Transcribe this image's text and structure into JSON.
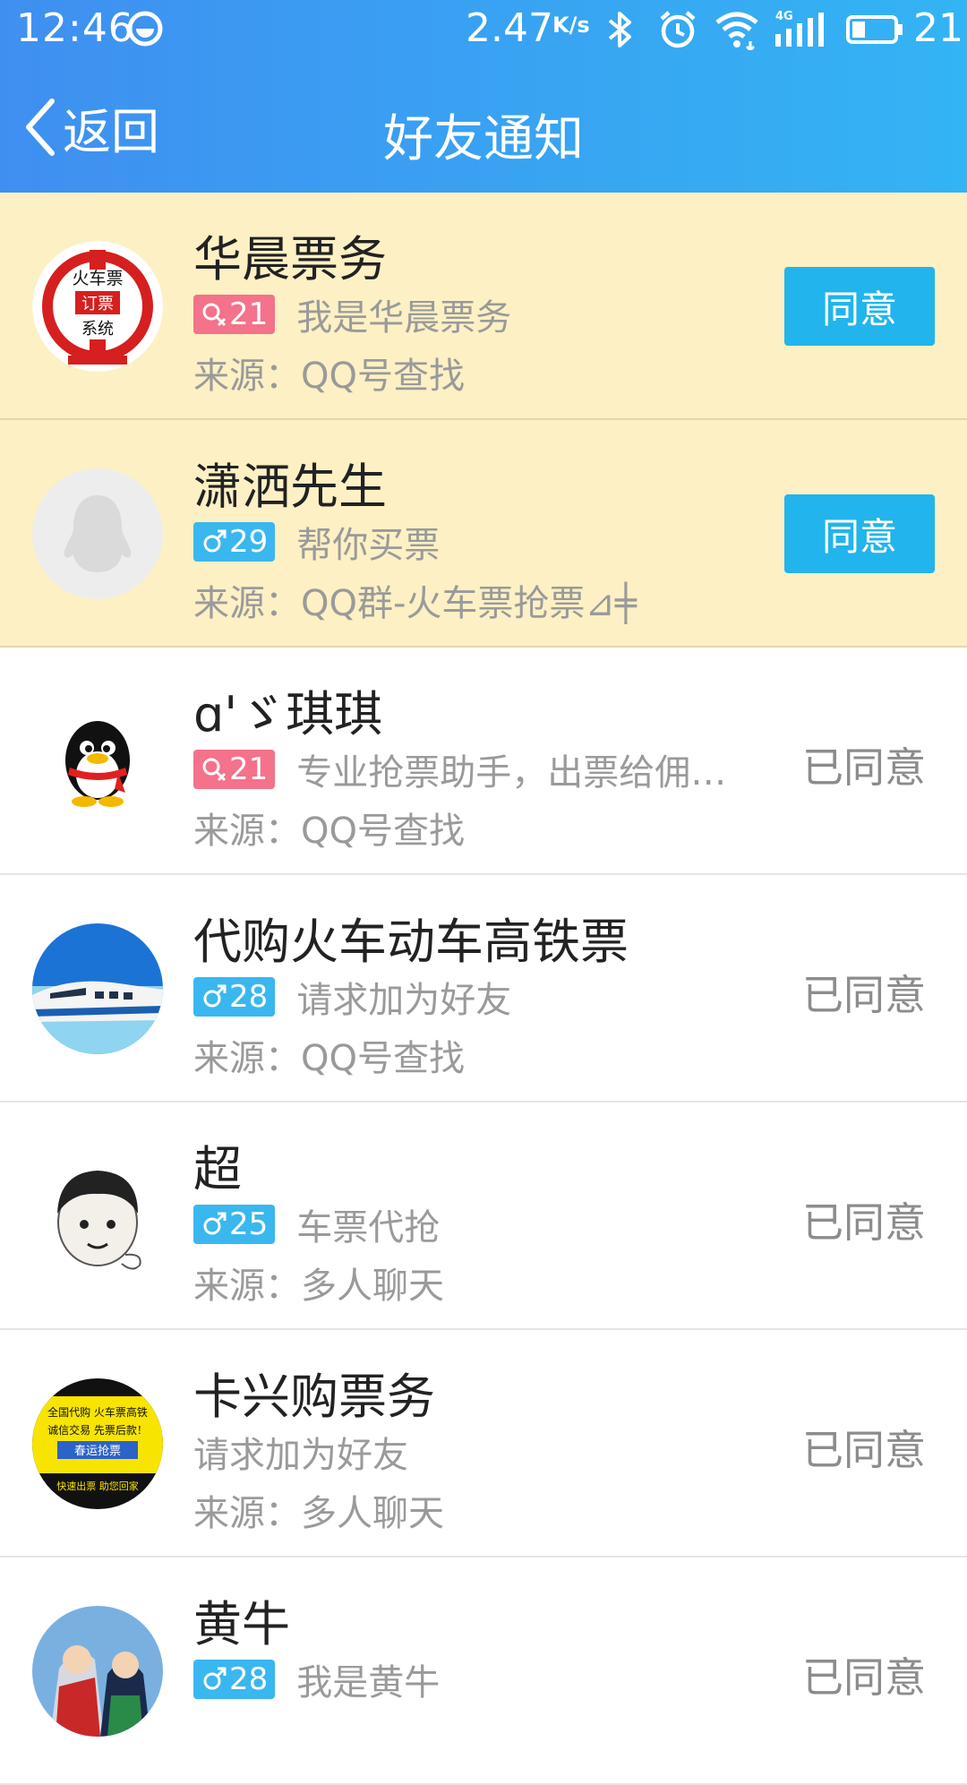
{
  "status_bar": {
    "time": "12:46",
    "speed": "2.47",
    "speed_unit": "K/s",
    "network": "4G",
    "battery": "21"
  },
  "title_bar": {
    "back_label": "返回",
    "title": "好友通知"
  },
  "colors": {
    "header_start": "#3f8ff0",
    "header_end": "#33b4f4",
    "pending_row_bg": "#fdf0c4",
    "agree_button": "#22b4ec",
    "female_badge": "#f4728a",
    "male_badge": "#3ab7ef"
  },
  "requests": [
    {
      "name": "华晨票务",
      "gender": "female",
      "gender_icon": "female-icon",
      "age": "21",
      "message": "我是华晨票务",
      "source": "来源：QQ号查找",
      "action": "同意",
      "avatar": "train-ticket-logo",
      "avatar_text": [
        "火车票",
        "订票",
        "系统"
      ]
    },
    {
      "name": "潇洒先生",
      "gender": "male",
      "gender_icon": "male-icon",
      "age": "29",
      "message": "帮你买票",
      "source": "来源：QQ群-火车票抢票⊿╪",
      "action": "同意",
      "avatar": "default-penguin-avatar"
    },
    {
      "name": "ɑ'ゞ琪琪",
      "gender": "female",
      "gender_icon": "female-icon",
      "age": "21",
      "message": "专业抢票助手，出票给佣…",
      "source": "来源：QQ号查找",
      "status": "已同意",
      "avatar": "qq-penguin-avatar"
    },
    {
      "name": "代购火车动车高铁票",
      "gender": "male",
      "gender_icon": "male-icon",
      "age": "28",
      "message": "请求加为好友",
      "source": "来源：QQ号查找",
      "status": "已同意",
      "avatar": "bullet-train-avatar"
    },
    {
      "name": "超",
      "gender": "male",
      "gender_icon": "male-icon",
      "age": "25",
      "message": "车票代抢",
      "source": "来源：多人聊天",
      "status": "已同意",
      "avatar": "cartoon-face-avatar"
    },
    {
      "name": "卡兴购票务",
      "message": "请求加为好友",
      "source": "来源：多人聊天",
      "status": "已同意",
      "avatar": "ticket-ad-avatar",
      "avatar_text": [
        "全国代购 火车票高铁",
        "诚信交易 先票后款！",
        "春运抢票",
        "快速出票 助您回家"
      ]
    },
    {
      "name": "黄牛",
      "gender": "male",
      "gender_icon": "male-icon",
      "age": "28",
      "message": "我是黄牛",
      "status": "已同意",
      "avatar": "anime-avatar"
    }
  ]
}
